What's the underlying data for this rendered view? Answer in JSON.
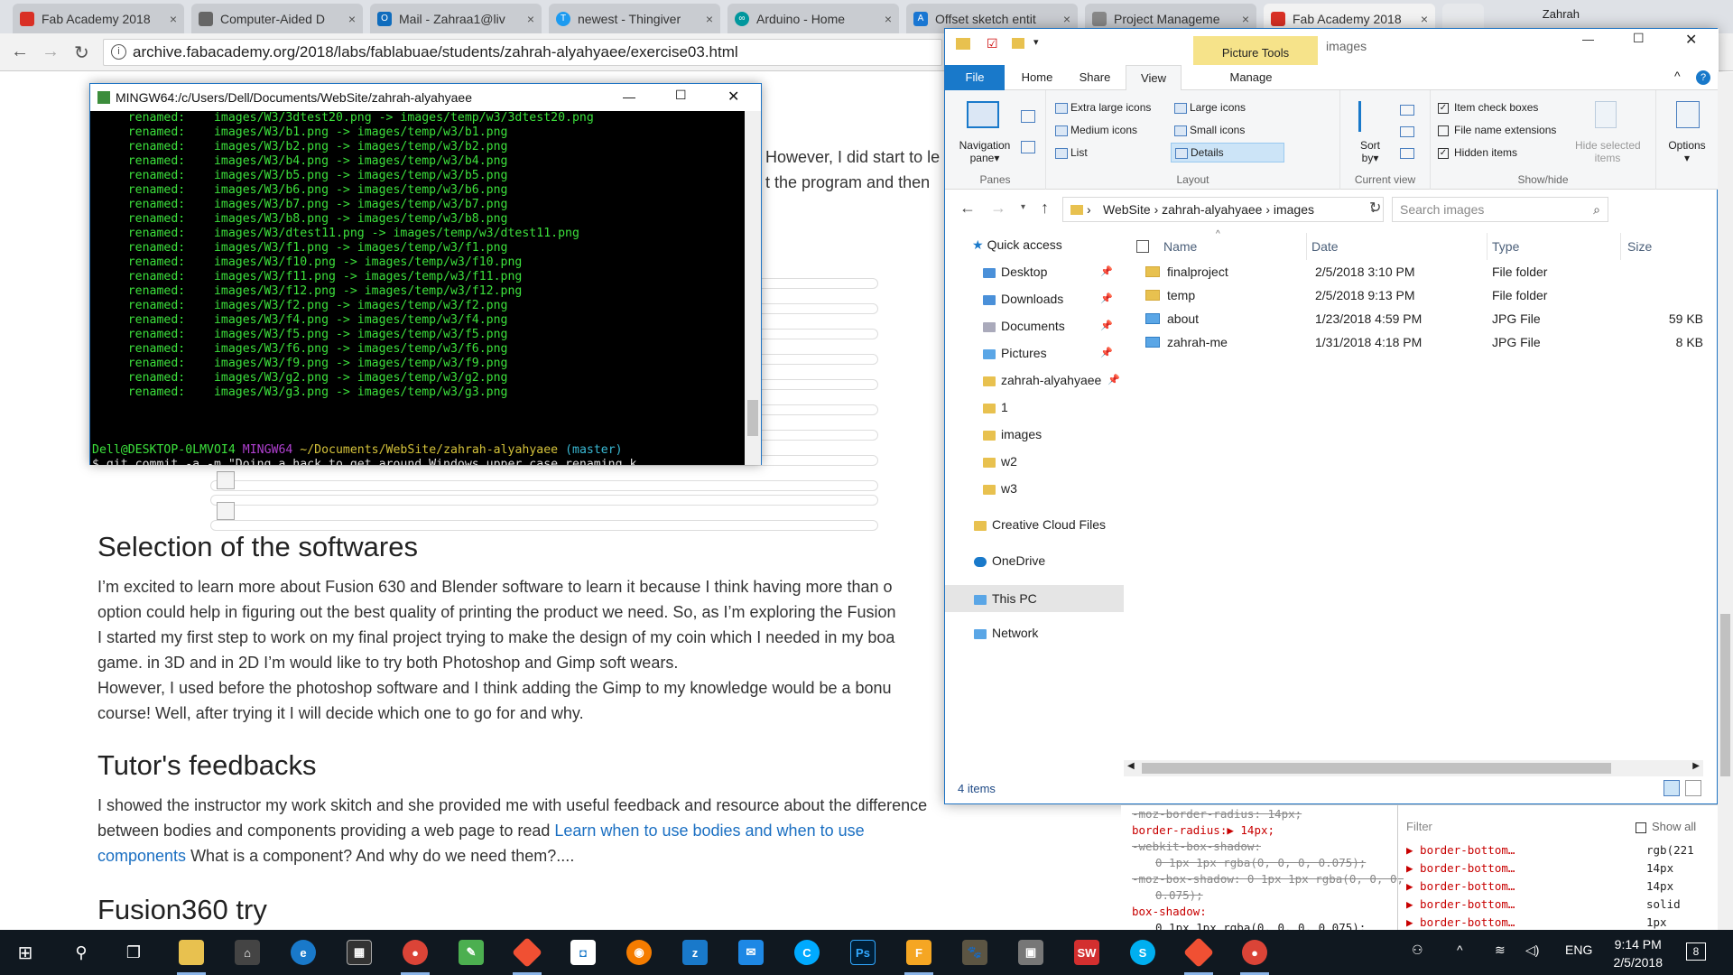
{
  "browser": {
    "tabs": [
      {
        "title": "Fab Academy 2018",
        "color": "#d93025"
      },
      {
        "title": "Computer-Aided D",
        "color": "#555555"
      },
      {
        "title": "Mail - Zahraa1@liv",
        "color": "#0f6cbd"
      },
      {
        "title": "newest - Thingiver",
        "color": "#1d9bf0"
      },
      {
        "title": "Arduino - Home",
        "color": "#00979d"
      },
      {
        "title": "Offset sketch entit",
        "color": "#1976d2"
      },
      {
        "title": "Project Manageme",
        "color": "#777777"
      },
      {
        "title": "Fab Academy 2018",
        "color": "#d93025"
      }
    ],
    "user": "Zahrah",
    "url": "archive.fabacademy.org/2018/labs/fablabuae/students/zahrah-alyahyaee/exercise03.html"
  },
  "page": {
    "frag1": "However, I did start to le",
    "frag2": "t the program and then",
    "h_selection": "Selection of the softwares",
    "p_selection": [
      "I’m excited to learn more about Fusion 630 and Blender software to learn it because I think having more than o",
      "option could help in figuring out the best quality of printing the product we need. So, as I’m exploring the Fusion",
      "I started my first step to work on my final project trying to make the design of my coin which I needed in my boa",
      "game. in 3D and in 2D I’m would like to try both Photoshop and Gimp soft wears.",
      "However, I used before the photoshop software and I think adding the Gimp to my knowledge would be a bonu",
      "course! Well, after trying it I will decide which one to go for and why."
    ],
    "h_tutor": "Tutor's feedbacks",
    "p_tutor_1": "I showed the instructor my work skitch and she provided me with useful feedback and resource about the difference",
    "p_tutor_2": "between bodies and components providing a web page to read",
    "p_tutor_link_1": "Learn when to use bodies and when to use",
    "p_tutor_link_2": "components",
    "p_tutor_3": " What is a component? And why do we need them?....",
    "h_fusion": "Fusion360 try"
  },
  "terminal": {
    "title": "MINGW64:/c/Users/Dell/Documents/WebSite/zahrah-alyahyaee",
    "lines": [
      "     renamed:    images/W3/3dtest20.png -> images/temp/w3/3dtest20.png",
      "     renamed:    images/W3/b1.png -> images/temp/w3/b1.png",
      "     renamed:    images/W3/b2.png -> images/temp/w3/b2.png",
      "     renamed:    images/W3/b4.png -> images/temp/w3/b4.png",
      "     renamed:    images/W3/b5.png -> images/temp/w3/b5.png",
      "     renamed:    images/W3/b6.png -> images/temp/w3/b6.png",
      "     renamed:    images/W3/b7.png -> images/temp/w3/b7.png",
      "     renamed:    images/W3/b8.png -> images/temp/w3/b8.png",
      "     renamed:    images/W3/dtest11.png -> images/temp/w3/dtest11.png",
      "     renamed:    images/W3/f1.png -> images/temp/w3/f1.png",
      "     renamed:    images/W3/f10.png -> images/temp/w3/f10.png",
      "     renamed:    images/W3/f11.png -> images/temp/w3/f11.png",
      "     renamed:    images/W3/f12.png -> images/temp/w3/f12.png",
      "     renamed:    images/W3/f2.png -> images/temp/w3/f2.png",
      "     renamed:    images/W3/f4.png -> images/temp/w3/f4.png",
      "     renamed:    images/W3/f5.png -> images/temp/w3/f5.png",
      "     renamed:    images/W3/f6.png -> images/temp/w3/f6.png",
      "     renamed:    images/W3/f9.png -> images/temp/w3/f9.png",
      "     renamed:    images/W3/g2.png -> images/temp/w3/g2.png",
      "     renamed:    images/W3/g3.png -> images/temp/w3/g3.png"
    ],
    "prompt_user": "Dell@DESKTOP-0LMVOI4",
    "prompt_shell": "MINGW64",
    "prompt_path": "~/Documents/WebSite/zahrah-alyahyaee",
    "prompt_branch": "(master)",
    "command": "$ git commit -a -m \"Doing a hack to get around Windows upper case renaming k"
  },
  "explorer": {
    "title": "images",
    "picture_tools": "Picture Tools",
    "menus": [
      "File",
      "Home",
      "Share",
      "View",
      "Manage"
    ],
    "ribbon": {
      "panes_label": "Panes",
      "nav_pane": "Navigation",
      "nav_pane2": "pane",
      "layout_items": [
        "Extra large icons",
        "Large icons",
        "Medium icons",
        "Small icons",
        "List",
        "Details"
      ],
      "layout_label": "Layout",
      "sort": "Sort",
      "sort2": "by",
      "current_view_label": "Current view",
      "checks": [
        {
          "label": "Item check boxes",
          "checked": true
        },
        {
          "label": "File name extensions",
          "checked": false
        },
        {
          "label": "Hidden items",
          "checked": true
        }
      ],
      "hide_selected": "Hide selected",
      "hide_selected2": "items",
      "showhide_label": "Show/hide",
      "options": "Options"
    },
    "crumbs": [
      "WebSite",
      "zahrah-alyahyaee",
      "images"
    ],
    "search_placeholder": "Search images",
    "nav": [
      {
        "label": "Quick access"
      },
      {
        "label": "Desktop"
      },
      {
        "label": "Downloads"
      },
      {
        "label": "Documents"
      },
      {
        "label": "Pictures"
      },
      {
        "label": "zahrah-alyahyaee"
      },
      {
        "label": "1"
      },
      {
        "label": "images"
      },
      {
        "label": "w2"
      },
      {
        "label": "w3"
      },
      {
        "label": "Creative Cloud Files"
      },
      {
        "label": "OneDrive"
      },
      {
        "label": "This PC"
      },
      {
        "label": "Network"
      }
    ],
    "columns": [
      "Name",
      "Date",
      "Type",
      "Size"
    ],
    "files": [
      {
        "name": "finalproject",
        "date": "2/5/2018 3:10 PM",
        "type": "File folder",
        "size": ""
      },
      {
        "name": "temp",
        "date": "2/5/2018 9:13 PM",
        "type": "File folder",
        "size": ""
      },
      {
        "name": "about",
        "date": "1/23/2018 4:59 PM",
        "type": "JPG File",
        "size": "59 KB"
      },
      {
        "name": "zahrah-me",
        "date": "1/31/2018 4:18 PM",
        "type": "JPG File",
        "size": "8 KB"
      }
    ],
    "status": "4 items"
  },
  "devtools": {
    "lines": [
      "-moz-border-radius: 14px;",
      "border-radius:▶ 14px;",
      "-webkit-box-shadow:",
      "0 1px 1px rgba(0, 0, 0, 0.075);",
      "-moz-box-shadow: 0 1px 1px rgba(0, 0, 0,",
      "0.075);",
      "box-shadow:",
      "0 1px 1px rgba(0, 0, 0, 0.075);"
    ],
    "filter": "Filter",
    "show_all": "Show all",
    "computed": [
      {
        "prop": "▶ border-bottom…",
        "val": "rgb(221"
      },
      {
        "prop": "▶ border-bottom…",
        "val": "14px"
      },
      {
        "prop": "▶ border-bottom…",
        "val": "14px"
      },
      {
        "prop": "▶ border-bottom…",
        "val": "solid"
      },
      {
        "prop": "▶ border-bottom…",
        "val": "1px"
      }
    ]
  },
  "taskbar": {
    "lang": "ENG",
    "time": "9:14 PM",
    "date": "2/5/2018",
    "notifications": "8"
  }
}
